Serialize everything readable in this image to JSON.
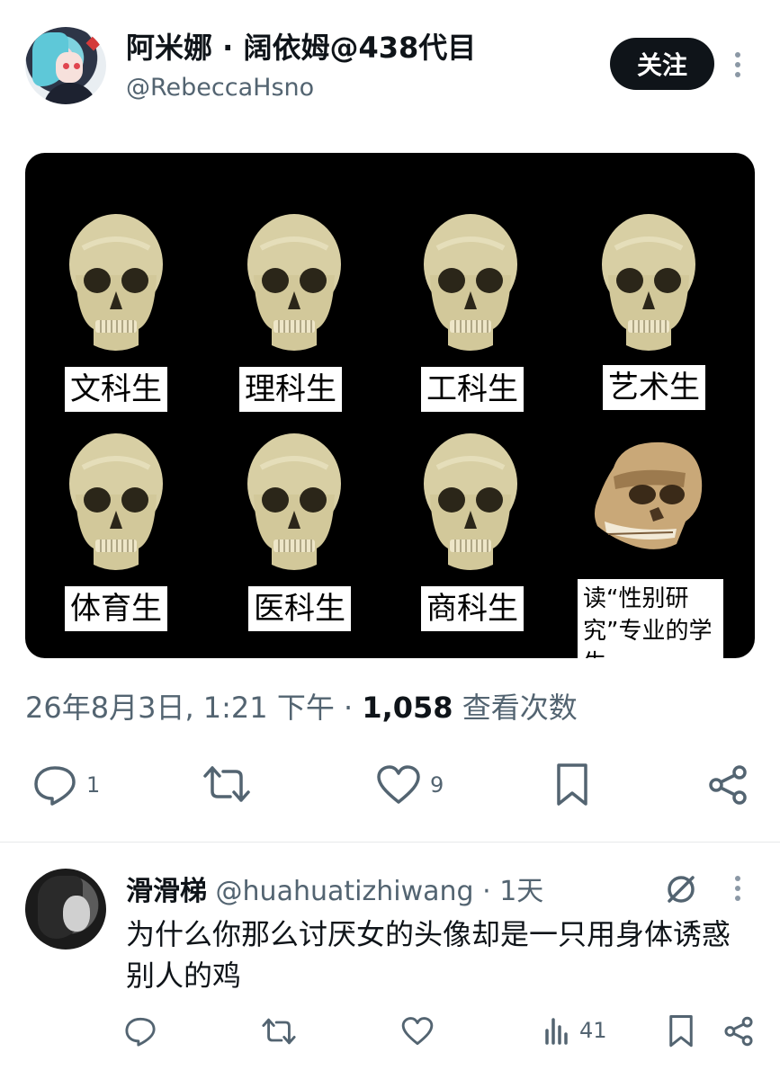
{
  "tweet": {
    "display_name": "阿米娜 · 阔依姆@438代目",
    "handle": "@RebeccaHsno",
    "follow_label": "关注",
    "meme_labels": [
      "文科生",
      "理科生",
      "工科生",
      "艺术生",
      "体育生",
      "医科生",
      "商科生",
      "读“性别研究”专业的学生"
    ],
    "timestamp": "26年8月3日, 1:21 下午",
    "separator": "·",
    "views_count": "1,058",
    "views_label": "查看次数",
    "actions": {
      "reply_count": "1",
      "retweet_count": "",
      "like_count": "9"
    }
  },
  "reply": {
    "display_name": "滑滑梯",
    "handle": "@huahuatizhiwang",
    "separator": "·",
    "time": "1天",
    "text": "为什么你那么讨厌女的头像却是一只用身体诱惑别人的鸡",
    "actions": {
      "views_count": "41"
    }
  },
  "colors": {
    "text_primary": "#0f1419",
    "text_secondary": "#536471",
    "follow_bg": "#0f1419",
    "meme_bg": "#000000",
    "skull": "#d8cfa4"
  },
  "icons": [
    "more-icon",
    "reply-icon",
    "retweet-icon",
    "like-icon",
    "bookmark-icon",
    "share-icon",
    "grok-icon",
    "views-icon"
  ]
}
